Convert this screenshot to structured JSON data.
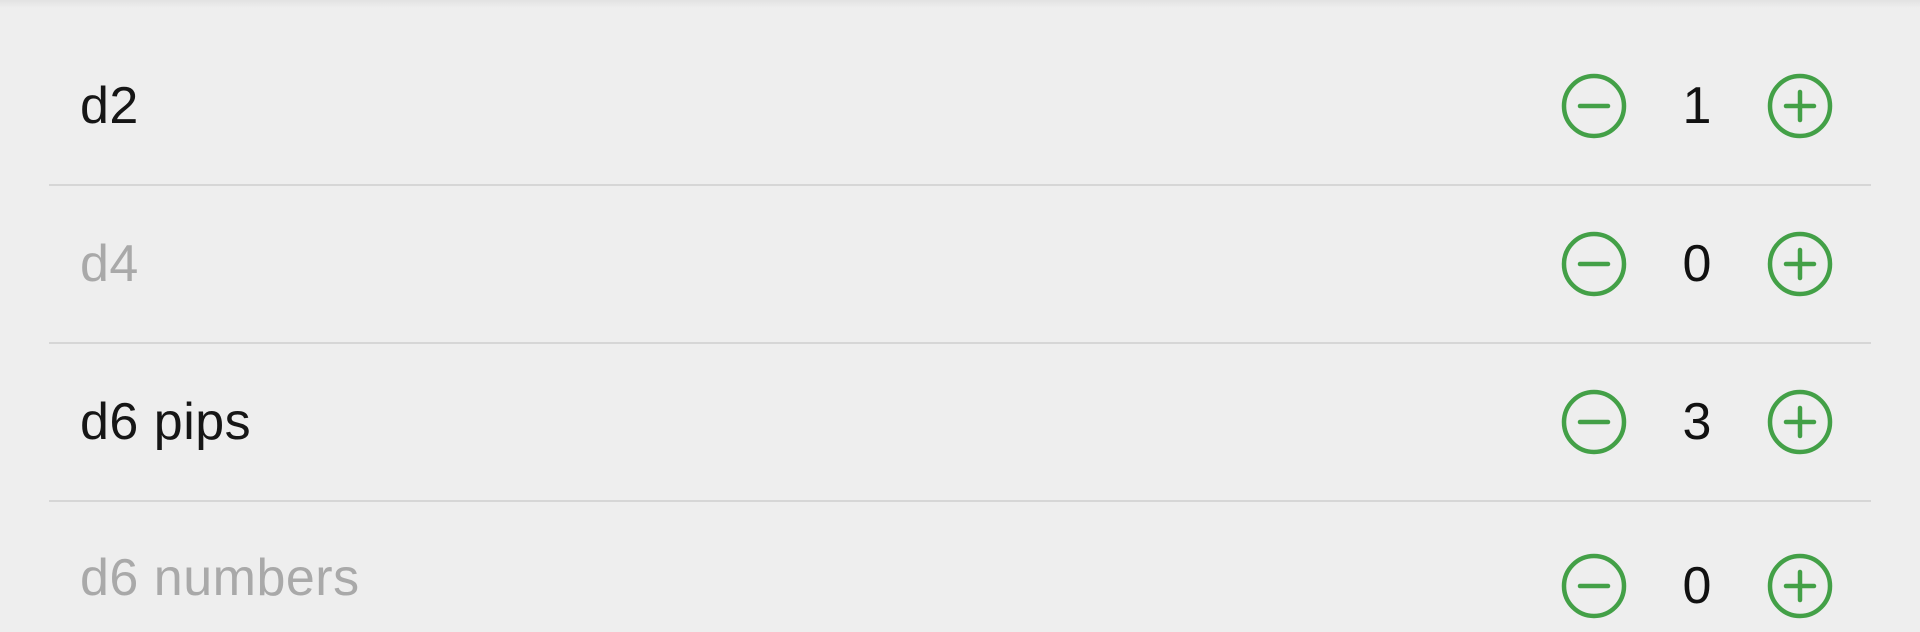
{
  "colors": {
    "accent": "#43a047",
    "active_text": "#161616",
    "inactive_text": "#a9a9a9",
    "background": "#eeeeee",
    "divider": "#d6d6d6"
  },
  "dice": [
    {
      "label": "d2",
      "count": "1",
      "active": true,
      "minus_icon": "minus-circle-icon",
      "plus_icon": "plus-circle-icon"
    },
    {
      "label": "d4",
      "count": "0",
      "active": false,
      "minus_icon": "minus-circle-icon",
      "plus_icon": "plus-circle-icon"
    },
    {
      "label": "d6 pips",
      "count": "3",
      "active": true,
      "minus_icon": "minus-circle-icon",
      "plus_icon": "plus-circle-icon"
    },
    {
      "label": "d6 numbers",
      "count": "0",
      "active": false,
      "minus_icon": "minus-circle-icon",
      "plus_icon": "plus-circle-icon"
    }
  ]
}
